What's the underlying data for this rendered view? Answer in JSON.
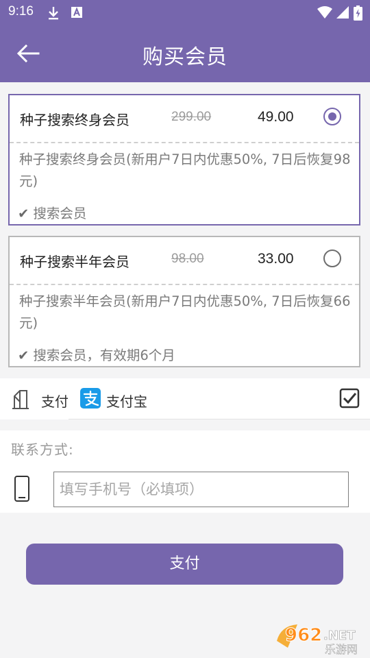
{
  "status_bar": {
    "time": "9:16",
    "icons": [
      "download-icon",
      "a-notification-icon",
      "wifi-icon",
      "signal-icon",
      "battery-icon"
    ]
  },
  "app_bar": {
    "title": "购买会员",
    "back_icon": "back-arrow-icon"
  },
  "plans": [
    {
      "name": "种子搜索终身会员",
      "original_price": "299.00",
      "price": "49.00",
      "selected": true,
      "description": "种子搜索终身会员(新用户7日内优惠50%, 7日后恢复98元)",
      "feature": "搜索会员"
    },
    {
      "name": "种子搜索半年会员",
      "original_price": "98.00",
      "price": "33.00",
      "selected": false,
      "description": "种子搜索半年会员(新用户7日内优惠50%, 7日后恢复66元)",
      "feature": "搜索会员，有效期6个月"
    }
  ],
  "payment": {
    "label": "支付",
    "method_name": "支付宝",
    "method_icon": "alipay-icon",
    "checked": true
  },
  "contact": {
    "label": "联系方式:",
    "icon": "phone-icon",
    "placeholder": "填写手机号（必填项）",
    "value": ""
  },
  "pay_button": {
    "label": "支付"
  },
  "watermark": {
    "brand": "962.NET",
    "sub": "乐游网"
  },
  "colors": {
    "primary": "#7666ad",
    "alipay": "#1a9be8",
    "background": "#f4f4f5"
  }
}
